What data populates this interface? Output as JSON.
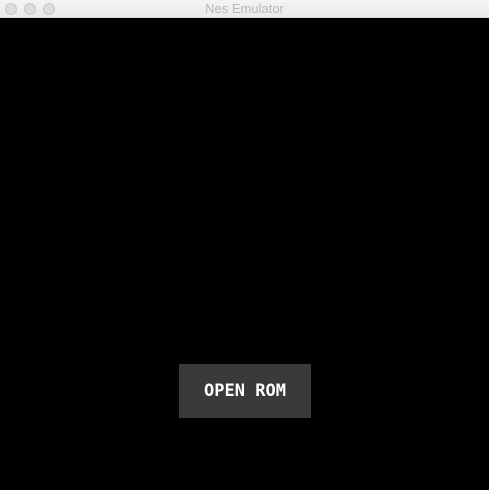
{
  "window": {
    "title": "Nes Emulator"
  },
  "screen": {
    "open_rom_label": "OPEN ROM"
  },
  "colors": {
    "screen_background": "#000000",
    "button_background": "#3a3a3a",
    "button_text": "#ffffff",
    "titlebar_text": "#b8b8b8"
  }
}
